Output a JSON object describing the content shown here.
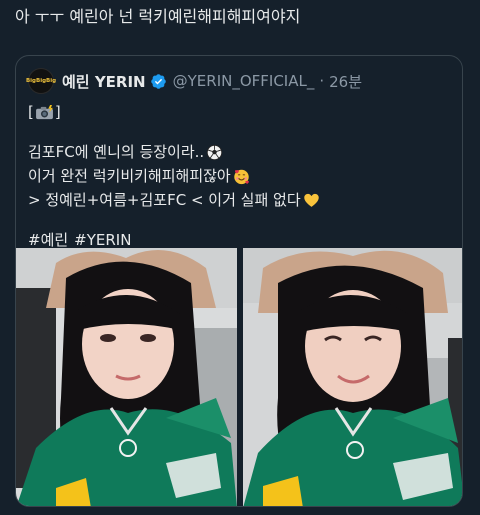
{
  "tweet": {
    "text": "아 ㅜㅜ 예린아 넌 럭키예린해피해피여야지"
  },
  "quoted": {
    "avatar_text": "BigBigBig",
    "display_name": "예린 YERIN",
    "verified_icon": "verified-badge-icon",
    "handle": "@YERIN_OFFICIAL_",
    "separator": "·",
    "time": "26분",
    "camera_prefix": "[",
    "camera_icon": "camera-flash-icon",
    "camera_suffix": "]",
    "line1": "김포FC에 옌니의 등장이라..",
    "line1_icon": "soccer-ball-icon",
    "line2": "이거 완전 럭키비키해피해피잖아",
    "line2_icon": "smiling-face-with-hearts-icon",
    "line3": "> 정예린+여름+김포FC < 이거 실패 없다",
    "line3_icon": "yellow-heart-icon",
    "hashtag1": "#예린",
    "hashtag2": "#YERIN"
  },
  "photos": [
    {
      "alt": "selfie-1"
    },
    {
      "alt": "selfie-2"
    }
  ],
  "colors": {
    "background": "#15202b",
    "text": "#e7e9ea",
    "muted": "#8b98a5",
    "border": "#38444d",
    "verified": "#1d9bf0",
    "jersey": "#0f7a5a"
  }
}
